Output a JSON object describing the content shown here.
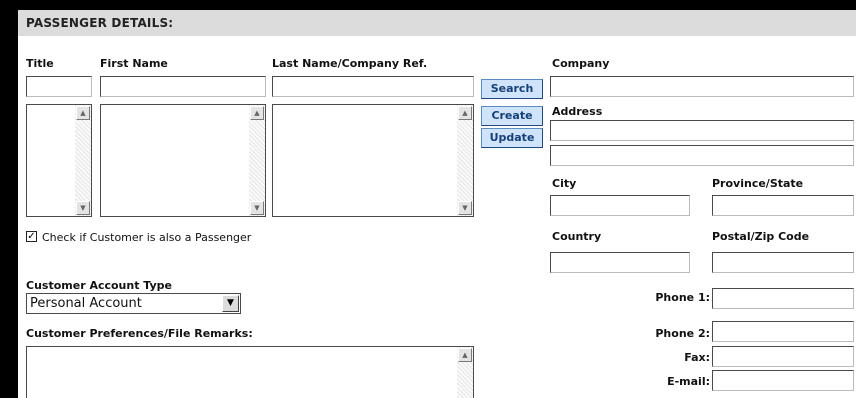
{
  "section": {
    "title": "PASSENGER DETAILS:"
  },
  "labels": {
    "title": "Title",
    "first_name": "First Name",
    "last_name": "Last Name/Company Ref.",
    "company": "Company",
    "address": "Address",
    "city": "City",
    "province": "Province/State",
    "country": "Country",
    "postal": "Postal/Zip Code",
    "phone1": "Phone 1:",
    "phone2": "Phone 2:",
    "fax": "Fax:",
    "email": "E-mail:",
    "account_type": "Customer Account Type",
    "preferences": "Customer Preferences/File Remarks:"
  },
  "buttons": {
    "search": "Search",
    "create": "Create",
    "update": "Update"
  },
  "checkbox": {
    "label": "Check if Customer is also a Passenger",
    "checked": true
  },
  "account_type": {
    "selected": "Personal Account"
  },
  "icons": {
    "scroll_up": "▲",
    "scroll_down": "▼",
    "dropdown": "▼",
    "check": "✓"
  }
}
